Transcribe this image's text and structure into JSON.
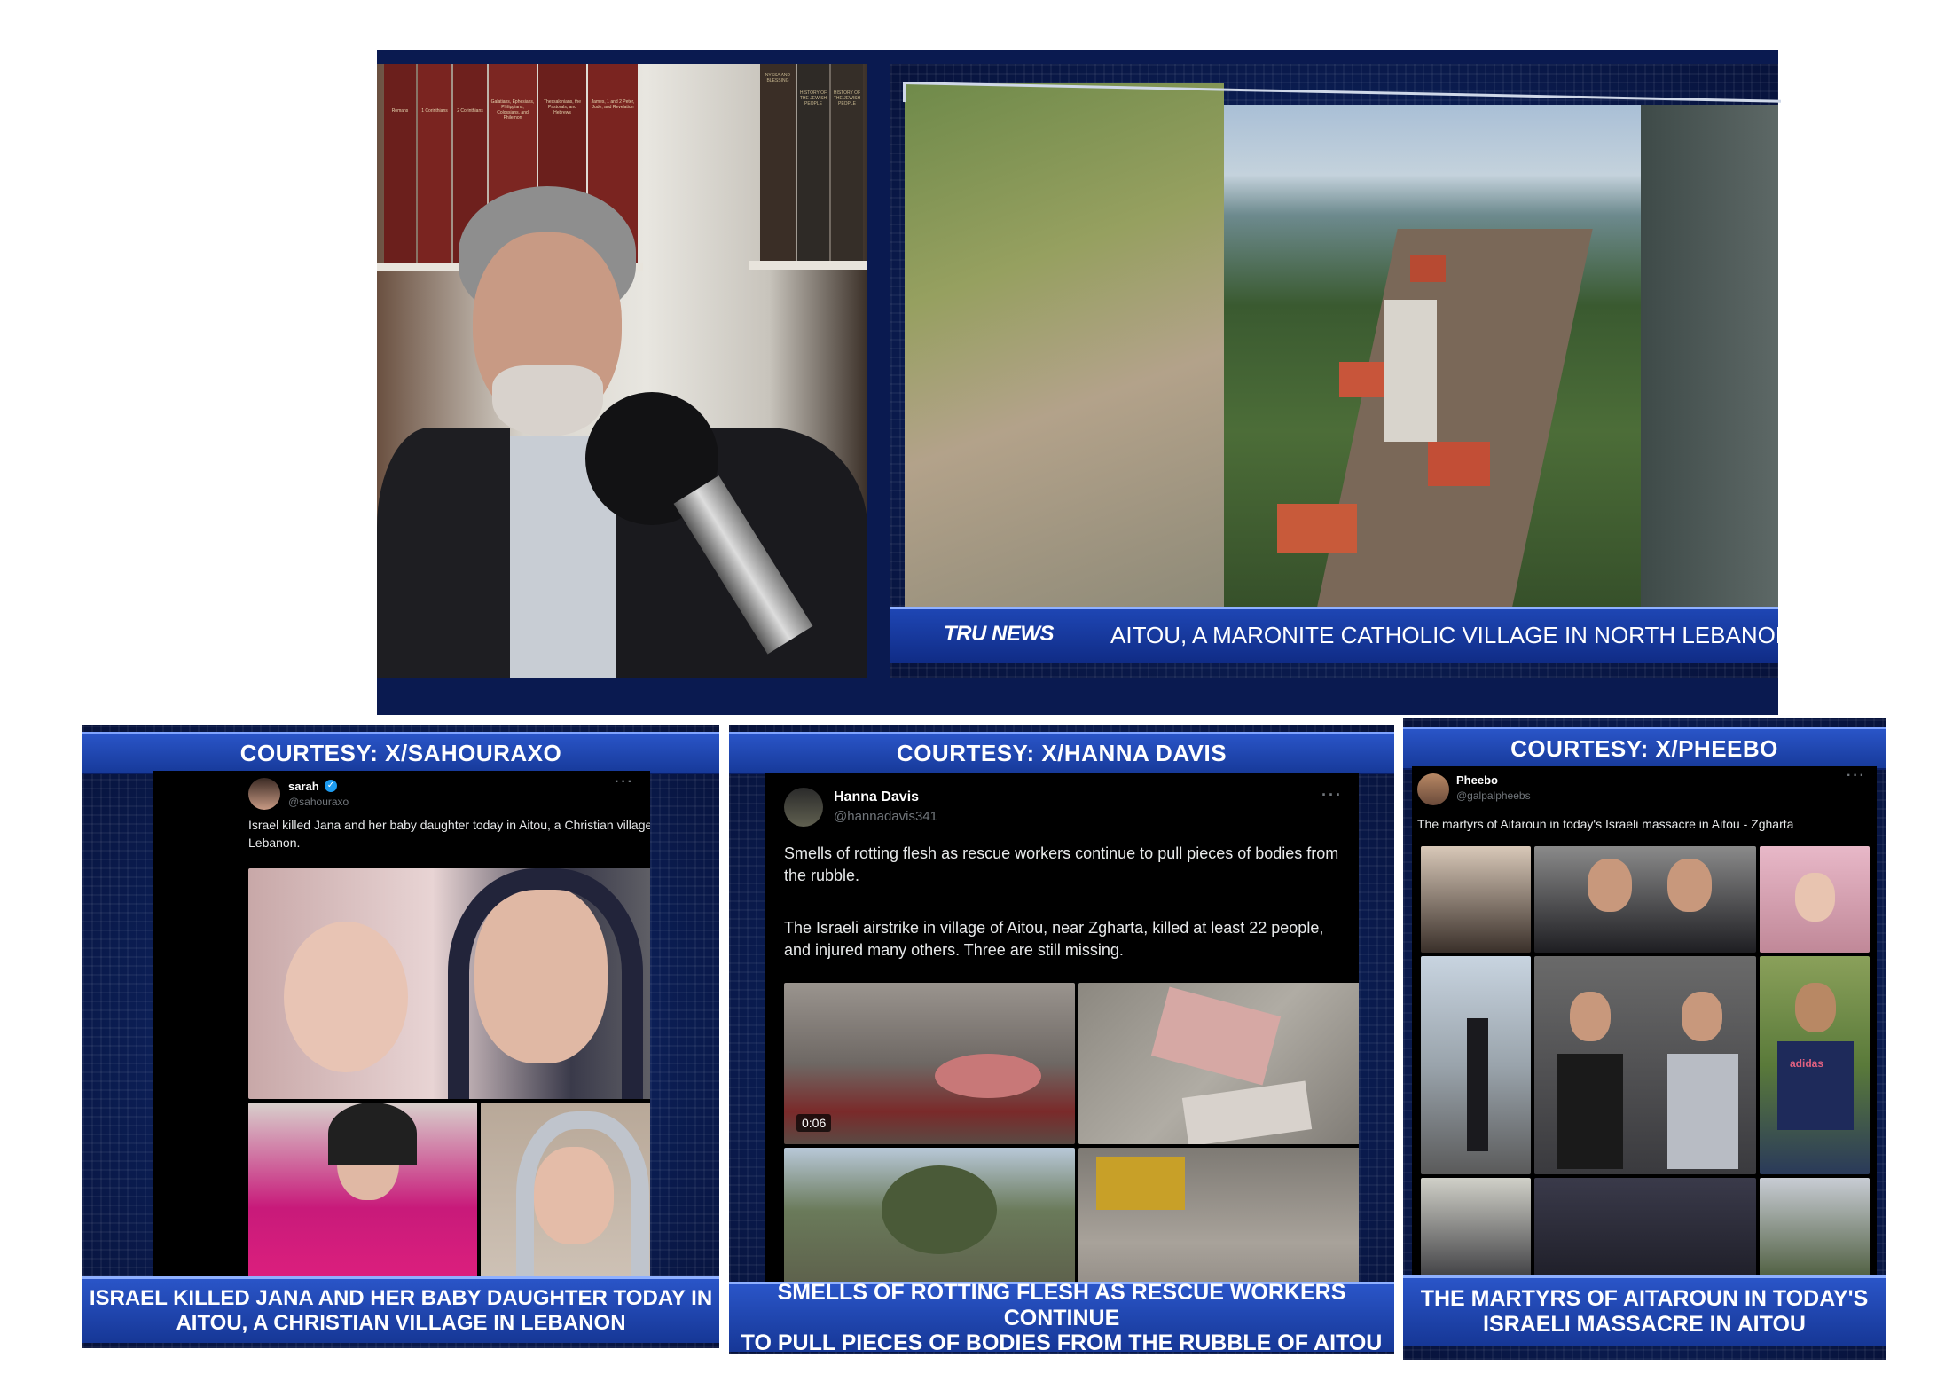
{
  "top": {
    "brand": "TRU NEWS",
    "caption": "AITOU, A MARONITE CATHOLIC VILLAGE IN NORTH LEBANON",
    "book_spines": [
      "Romans",
      "1 Corinthians",
      "2 Corinthians",
      "Galatians, Ephesians, Philippians, Colossians, and Philemon",
      "Thessalonians, the Pastorals, and Hebrews",
      "James, 1 and 2 Peter, Jude, and Revelation",
      "NYSSA AND BLESSING",
      "HISTORY OF THE JEWISH PEOPLE",
      "HISTORY OF THE JEWISH PEOPLE",
      "MAIER"
    ]
  },
  "panels": [
    {
      "courtesy": "COURTESY: X/SAHOURAXO",
      "name": "sarah",
      "handle": "@sahouraxo",
      "verified": true,
      "text": "Israel killed Jana and her baby daughter today in Aitou, a Christian village in Lebanon.",
      "caption_line1": "ISRAEL KILLED JANA AND HER BABY DAUGHTER TODAY IN",
      "caption_line2": "AITOU, A CHRISTIAN VILLAGE IN LEBANON"
    },
    {
      "courtesy": "COURTESY: X/HANNA DAVIS",
      "name": "Hanna Davis",
      "handle": "@hannadavis341",
      "text_p1": "Smells of rotting flesh as rescue workers continue to pull pieces of bodies from the rubble.",
      "text_p2": "The Israeli airstrike in village of Aitou, near Zgharta, killed at least 22 people, and injured many others. Three are still missing.",
      "video_time": "0:06",
      "caption_line1": "SMELLS OF ROTTING FLESH AS RESCUE WORKERS CONTINUE",
      "caption_line2": "TO PULL PIECES OF BODIES FROM THE RUBBLE OF AITOU"
    },
    {
      "courtesy": "COURTESY: X/PHEEBO",
      "name": "Pheebo",
      "handle": "@galpalpheebs",
      "text": "The martyrs of Aitaroun in today's Israeli massacre in Aitou - Zgharta",
      "shirt_text": "adidas",
      "caption_line1": "THE MARTYRS OF AITAROUN IN TODAY'S",
      "caption_line2": "ISRAELI MASSACRE IN AITOU"
    }
  ],
  "more_icon": "more-dots-icon",
  "colors": {
    "banner_blue": "#2a55c8",
    "navy": "#0b1d52",
    "tweet_bg": "#000000"
  }
}
